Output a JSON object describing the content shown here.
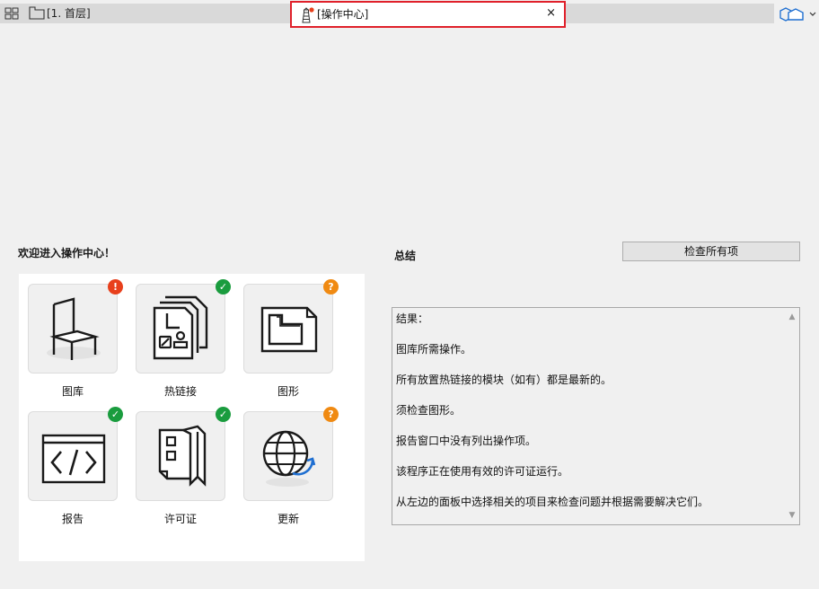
{
  "tabs": {
    "plan_tab_label": "[1. 首层]",
    "active_tab_label": "[操作中心]",
    "close_glyph": "×"
  },
  "welcome_heading": "欢迎进入操作中心！",
  "summary": {
    "title": "总结",
    "check_all_button": "检查所有项",
    "results": [
      "结果：",
      "图库所需操作。",
      "所有放置热链接的模块（如有）都是最新的。",
      "须检查图形。",
      "报告窗口中没有列出操作项。",
      "该程序正在使用有效的许可证运行。",
      "从左边的面板中选择相关的项目来检查问题并根据需要解决它们。"
    ]
  },
  "tiles": [
    {
      "label": "图库",
      "icon": "chair-icon",
      "status": "error",
      "badge": "!"
    },
    {
      "label": "热链接",
      "icon": "hotlink-icon",
      "status": "ok",
      "badge": "✓"
    },
    {
      "label": "图形",
      "icon": "drawing-icon",
      "status": "unknown",
      "badge": "?"
    },
    {
      "label": "报告",
      "icon": "code-icon",
      "status": "ok",
      "badge": "✓"
    },
    {
      "label": "许可证",
      "icon": "license-icon",
      "status": "ok",
      "badge": "✓"
    },
    {
      "label": "更新",
      "icon": "globe-update-icon",
      "status": "unknown",
      "badge": "?"
    }
  ],
  "colors": {
    "error": "#e8401c",
    "ok": "#1a9c3e",
    "unknown": "#f08a12",
    "active_tab_outline": "#e0202a",
    "accent_blue": "#1f6fd1"
  }
}
